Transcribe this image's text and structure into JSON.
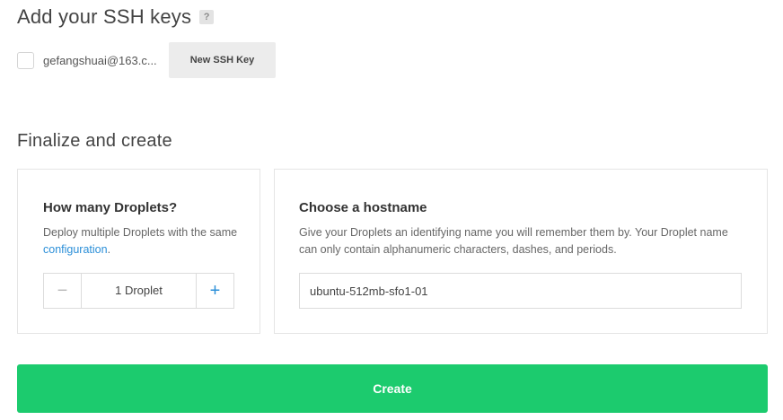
{
  "ssh": {
    "title": "Add your SSH keys",
    "help_icon": "?",
    "keys": [
      {
        "label": "gefangshuai@163.c...",
        "checked": false
      }
    ],
    "new_key_label": "New SSH Key"
  },
  "finalize": {
    "title": "Finalize and create",
    "droplets": {
      "title": "How many Droplets?",
      "desc_prefix": "Deploy multiple Droplets with the same ",
      "desc_link": "configuration",
      "desc_suffix": ".",
      "count_label": "1 Droplet",
      "minus_icon": "−",
      "plus_icon": "+"
    },
    "hostname": {
      "title": "Choose a hostname",
      "desc": "Give your Droplets an identifying name you will remember them by. Your Droplet name can only contain alphanumeric characters, dashes, and periods.",
      "value": "ubuntu-512mb-sfo1-01"
    }
  },
  "create_label": "Create",
  "colors": {
    "accent_green": "#1ccb6e",
    "link_blue": "#2b8fd8"
  }
}
